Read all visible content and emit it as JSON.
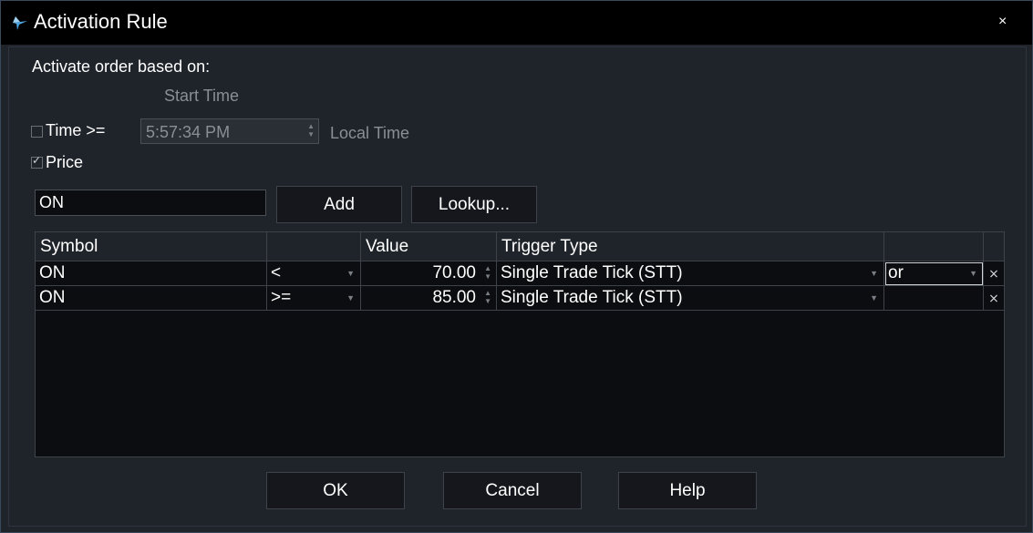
{
  "window": {
    "title": "Activation Rule",
    "close_label": "×"
  },
  "form": {
    "heading": "Activate order based on:",
    "start_time_label": "Start Time",
    "time_checkbox_label": "Time >=",
    "time_checked": false,
    "time_value": "5:57:34 PM",
    "local_time_label": "Local Time",
    "price_checkbox_label": "Price",
    "price_checked": true,
    "symbol_value": "ON",
    "add_label": "Add",
    "lookup_label": "Lookup..."
  },
  "grid": {
    "headers": {
      "symbol": "Symbol",
      "op": "",
      "value": "Value",
      "trigger": "Trigger Type",
      "logic": ""
    },
    "rows": [
      {
        "symbol": "ON",
        "op": "<",
        "value": "70.00",
        "trigger": "Single Trade Tick (STT)",
        "logic": "or"
      },
      {
        "symbol": "ON",
        "op": ">=",
        "value": "85.00",
        "trigger": "Single Trade Tick (STT)",
        "logic": ""
      }
    ]
  },
  "buttons": {
    "ok": "OK",
    "cancel": "Cancel",
    "help": "Help"
  },
  "icons": {
    "app": "arrow-logo-icon",
    "delete": "delete-row-icon"
  },
  "colors": {
    "background": "#1f232a",
    "titlebar": "#000000",
    "grid_bg": "#0c0d10",
    "accent": "#4aa3df"
  }
}
